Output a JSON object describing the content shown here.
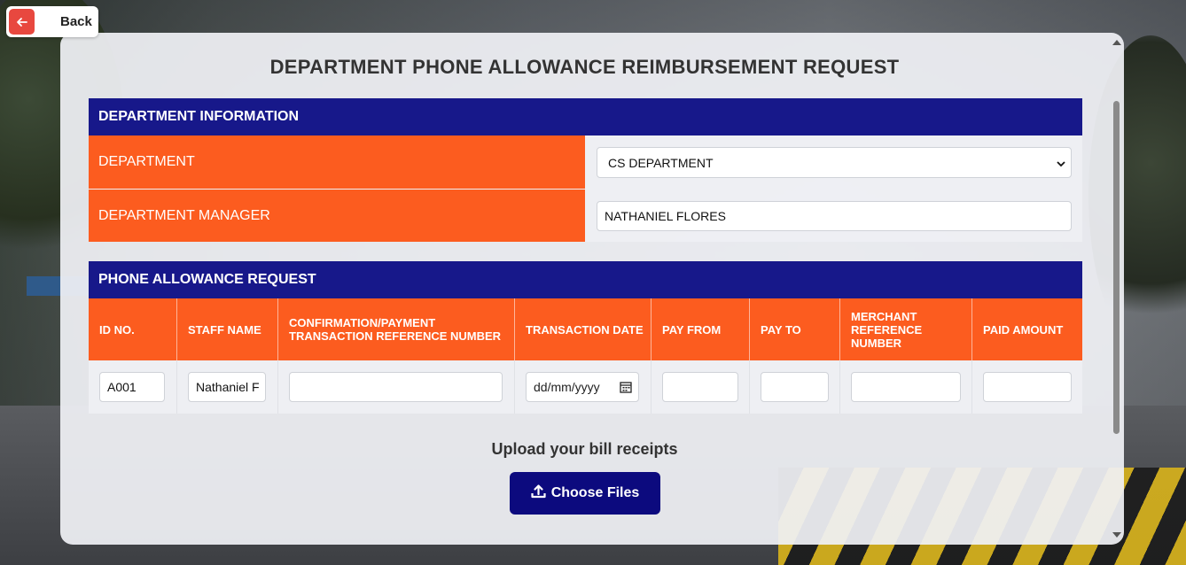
{
  "back_button": {
    "label": "Back",
    "icon": "arrow-left-icon",
    "color": "#e8483f"
  },
  "page": {
    "title": "DEPARTMENT PHONE ALLOWANCE REIMBURSEMENT REQUEST"
  },
  "department_info": {
    "heading": "DEPARTMENT INFORMATION",
    "department_label": "DEPARTMENT",
    "department_value": "CS DEPARTMENT",
    "manager_label": "DEPARTMENT MANAGER",
    "manager_value": "NATHANIEL FLORES"
  },
  "phone_request": {
    "heading": "PHONE ALLOWANCE REQUEST",
    "columns": [
      "ID NO.",
      "STAFF NAME",
      "CONFIRMATION/PAYMENT TRANSACTION REFERENCE NUMBER",
      "TRANSACTION DATE",
      "PAY FROM",
      "PAY TO",
      "MERCHANT REFERENCE NUMBER",
      "PAID AMOUNT"
    ],
    "row": {
      "id_no": "A001",
      "staff_name": "Nathaniel F",
      "confirmation_ref": "",
      "transaction_date_placeholder": "dd/mm/yyyy",
      "pay_from": "",
      "pay_to": "",
      "merchant_ref": "",
      "paid_amount": ""
    }
  },
  "upload": {
    "label": "Upload your bill receipts",
    "button_label": "Choose Files",
    "icon": "upload-icon"
  },
  "colors": {
    "header_blue": "#17188a",
    "label_orange": "#fc5c1f",
    "upload_button": "#0c0a7e"
  }
}
